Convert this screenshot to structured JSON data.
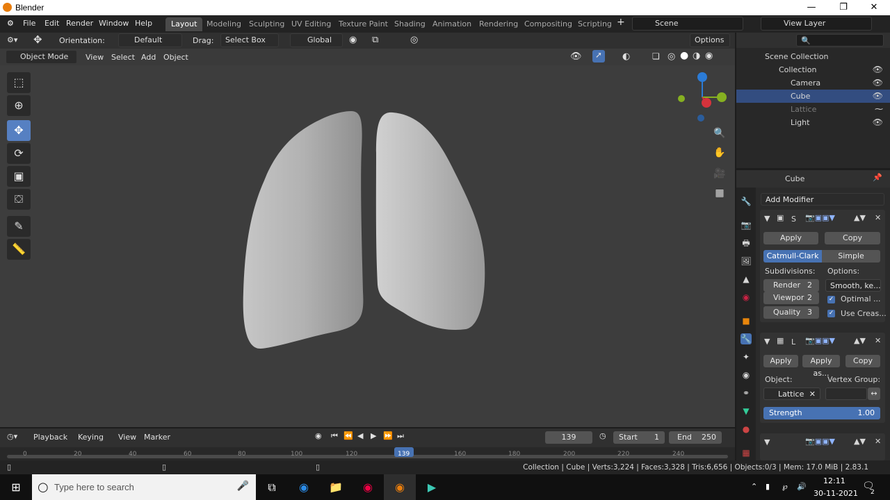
{
  "window": {
    "title": "Blender"
  },
  "menubar": {
    "items": [
      "File",
      "Edit",
      "Render",
      "Window",
      "Help"
    ]
  },
  "workspaces": [
    "Layout",
    "Modeling",
    "Sculpting",
    "UV Editing",
    "Texture Paint",
    "Shading",
    "Animation",
    "Rendering",
    "Compositing",
    "Scripting"
  ],
  "scene": {
    "name": "Scene",
    "view_layer": "View Layer"
  },
  "toolheader": {
    "orientation_label": "Orientation:",
    "orientation_value": "Default",
    "drag_label": "Drag:",
    "drag_value": "Select Box",
    "transform": "Global",
    "options": "Options"
  },
  "viewport_header": {
    "mode": "Object Mode",
    "menus": [
      "View",
      "Select",
      "Add",
      "Object"
    ]
  },
  "outliner": {
    "root": "Scene Collection",
    "collection": "Collection",
    "objects": [
      "Camera",
      "Cube",
      "Lattice",
      "Light"
    ]
  },
  "properties": {
    "object": "Cube",
    "add_modifier": "Add Modifier",
    "subsurf": {
      "name": "S",
      "apply": "Apply",
      "copy": "Copy",
      "catmull": "Catmull-Clark",
      "simple": "Simple",
      "subdivisions_label": "Subdivisions:",
      "options_label": "Options:",
      "render_label": "Render",
      "render_val": "2",
      "viewport_label": "Viewpor",
      "viewport_val": "2",
      "quality_label": "Quality",
      "quality_val": "3",
      "smooth": "Smooth, ke...",
      "optimal": "Optimal ...",
      "use_crease": "Use Creas..."
    },
    "lattice": {
      "name": "L",
      "apply": "Apply",
      "apply_as": "Apply as...",
      "copy": "Copy",
      "object_label": "Object:",
      "vgroup_label": "Vertex Group:",
      "object_val": "Lattice",
      "strength_label": "Strength",
      "strength_val": "1.00"
    }
  },
  "timeline": {
    "menus": [
      "Playback",
      "Keying",
      "View",
      "Marker"
    ],
    "current": "139",
    "start_label": "Start",
    "start": "1",
    "end_label": "End",
    "end": "250",
    "ticks": [
      "0",
      "20",
      "40",
      "60",
      "80",
      "100",
      "120",
      "139",
      "160",
      "180",
      "200",
      "220",
      "240"
    ]
  },
  "statusbar": {
    "text": "Collection | Cube | Verts:3,224 | Faces:3,328 | Tris:6,656 | Objects:0/3 | Mem: 17.0 MiB | 2.83.1"
  },
  "taskbar": {
    "search_placeholder": "Type here to search",
    "time": "12:11",
    "date": "30-11-2021",
    "notif": "2"
  },
  "colors": {
    "accent": "#4772b3",
    "viewport_bg": "#3d3d3d",
    "mesh": "#b8b8b8"
  }
}
